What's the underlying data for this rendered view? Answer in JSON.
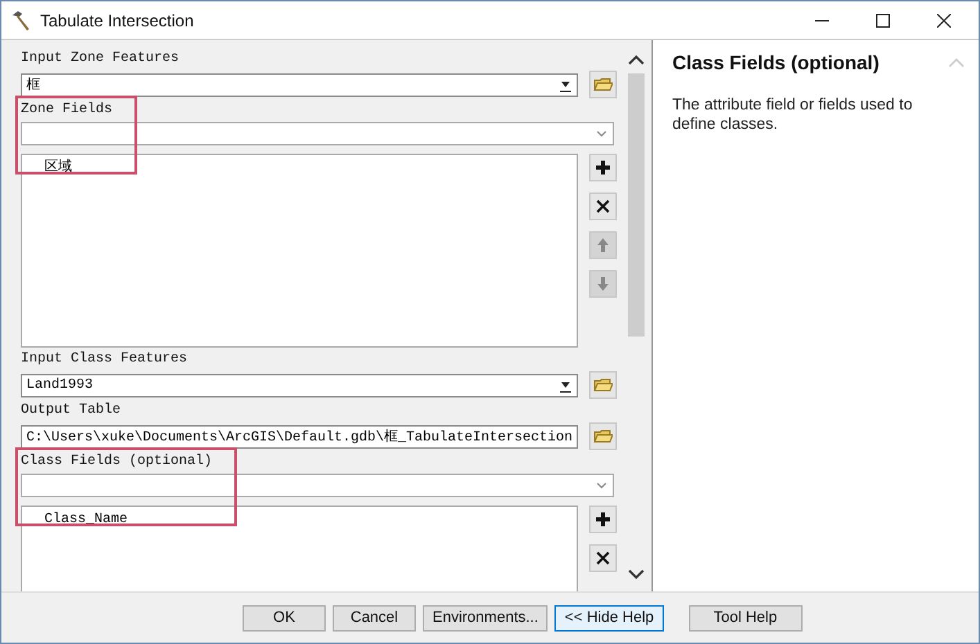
{
  "window": {
    "title": "Tabulate Intersection"
  },
  "params": [
    {
      "kind": "combo",
      "label": "Input Zone Features",
      "value": "框"
    },
    {
      "kind": "field_list",
      "label": "Zone Fields",
      "highlighted": true,
      "items": [
        "区域"
      ],
      "tools": [
        {
          "kind": "add",
          "disabled": false
        },
        {
          "kind": "remove",
          "disabled": false
        },
        {
          "kind": "up",
          "disabled": true
        },
        {
          "kind": "down",
          "disabled": true
        }
      ]
    },
    {
      "kind": "combo",
      "label": "Input Class Features",
      "value": "Land1993"
    },
    {
      "kind": "text",
      "label": "Output Table",
      "value": "C:\\Users\\xuke\\Documents\\ArcGIS\\Default.gdb\\框_TabulateIntersection"
    },
    {
      "kind": "field_list",
      "label": "Class Fields (optional)",
      "highlighted": true,
      "items": [
        "Class_Name"
      ],
      "tools": [
        {
          "kind": "add",
          "disabled": false
        },
        {
          "kind": "remove",
          "disabled": false
        }
      ]
    }
  ],
  "help": {
    "title": "Class Fields (optional)",
    "text": "The attribute field or fields used to define classes."
  },
  "buttons": [
    {
      "label": "OK",
      "selected": false
    },
    {
      "label": "Cancel",
      "selected": false
    },
    {
      "label": "Environments...",
      "selected": false
    },
    {
      "label": "<< Hide Help",
      "selected": true
    },
    {
      "label": "Tool Help",
      "selected": false
    }
  ]
}
